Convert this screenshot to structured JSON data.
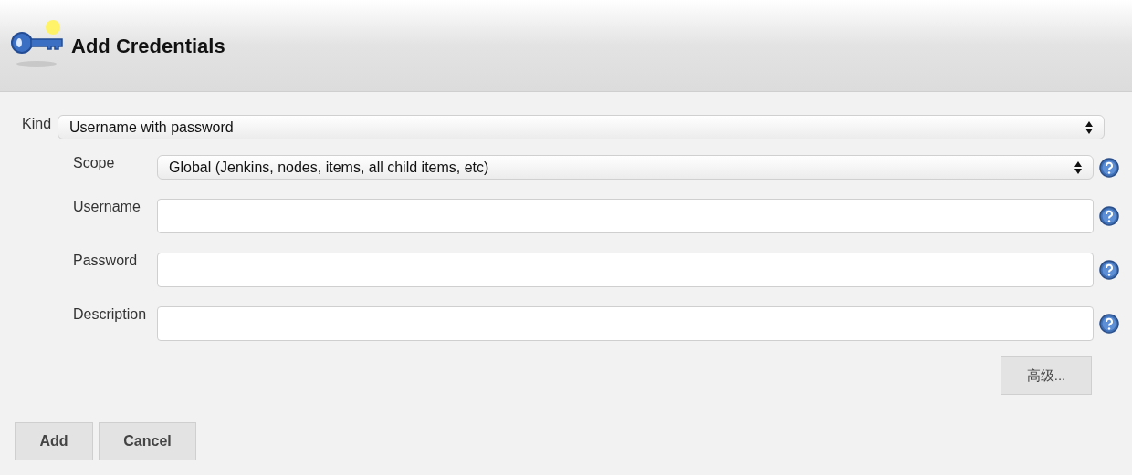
{
  "header": {
    "title": "Add Credentials"
  },
  "kind": {
    "label": "Kind",
    "value": "Username with password"
  },
  "fields": [
    {
      "kind": "select",
      "label": "Scope",
      "value": "Global (Jenkins, nodes, items, all child items, etc)"
    },
    {
      "kind": "text",
      "label": "Username"
    },
    {
      "kind": "text",
      "label": "Password"
    },
    {
      "kind": "text",
      "label": "Description"
    }
  ],
  "advanced_button": "高级...",
  "buttons": [
    "Add",
    "Cancel"
  ]
}
